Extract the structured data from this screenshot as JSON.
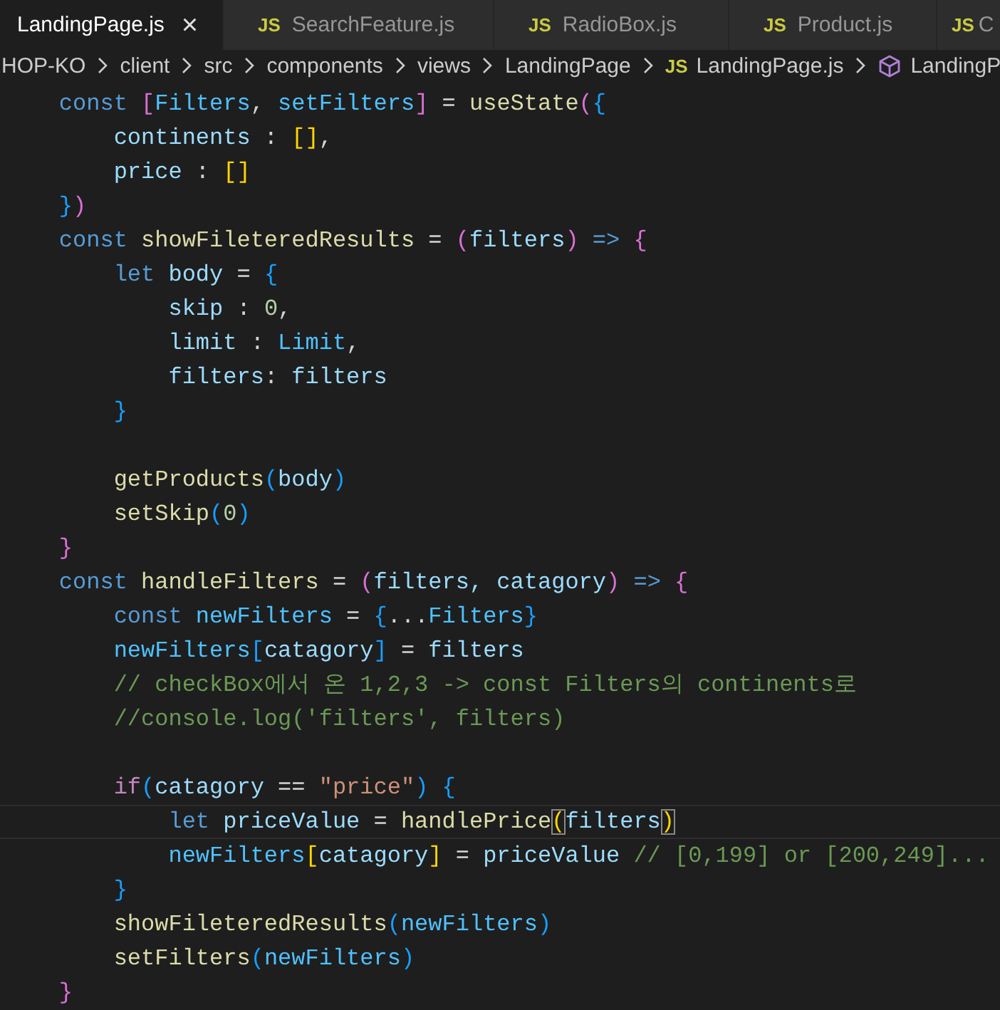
{
  "tabs": [
    {
      "label": "LandingPage.js",
      "selected": true,
      "close": "×"
    },
    {
      "badge": "JS",
      "label": "SearchFeature.js",
      "selected": false
    },
    {
      "badge": "JS",
      "label": "RadioBox.js",
      "selected": false
    },
    {
      "badge": "JS",
      "label": "Product.js",
      "selected": false
    },
    {
      "badge": "JS",
      "label": "C",
      "selected": false
    }
  ],
  "breadcrumb": [
    {
      "kind": "folder",
      "label": "HOP-KO"
    },
    {
      "kind": "folder",
      "label": "client"
    },
    {
      "kind": "folder",
      "label": "src"
    },
    {
      "kind": "folder",
      "label": "components"
    },
    {
      "kind": "folder",
      "label": "views"
    },
    {
      "kind": "folder",
      "label": "LandingPage"
    },
    {
      "kind": "file",
      "badge": "JS",
      "label": "LandingPage.js"
    },
    {
      "kind": "symbol",
      "label": "LandingP"
    }
  ],
  "code": [
    {
      "current": false,
      "tokens": [
        {
          "kind": "kw",
          "text": "    const "
        },
        {
          "kind": "b2",
          "text": "["
        },
        {
          "kind": "cst",
          "text": "Filters"
        },
        {
          "kind": "txt",
          "text": ", "
        },
        {
          "kind": "cst",
          "text": "setFilters"
        },
        {
          "kind": "b2",
          "text": "]"
        },
        {
          "kind": "txt",
          "text": " = "
        },
        {
          "kind": "fn",
          "text": "useState"
        },
        {
          "kind": "b2",
          "text": "("
        },
        {
          "kind": "b3",
          "text": "{"
        }
      ]
    },
    {
      "current": false,
      "tokens": [
        {
          "kind": "var",
          "text": "        continents"
        },
        {
          "kind": "txt",
          "text": " : "
        },
        {
          "kind": "b1",
          "text": "[]"
        },
        {
          "kind": "txt",
          "text": ","
        }
      ]
    },
    {
      "current": false,
      "tokens": [
        {
          "kind": "var",
          "text": "        price"
        },
        {
          "kind": "txt",
          "text": " : "
        },
        {
          "kind": "b1",
          "text": "[]"
        }
      ]
    },
    {
      "current": false,
      "tokens": [
        {
          "kind": "b3",
          "text": "    }"
        },
        {
          "kind": "b2",
          "text": ")"
        }
      ]
    },
    {
      "current": false,
      "tokens": [
        {
          "kind": "kw",
          "text": "    const "
        },
        {
          "kind": "fn",
          "text": "showFileteredResults"
        },
        {
          "kind": "txt",
          "text": " = "
        },
        {
          "kind": "b2",
          "text": "("
        },
        {
          "kind": "var",
          "text": "filters"
        },
        {
          "kind": "b2",
          "text": ")"
        },
        {
          "kind": "kw",
          "text": " => "
        },
        {
          "kind": "b2",
          "text": "{"
        }
      ]
    },
    {
      "current": false,
      "tokens": [
        {
          "kind": "kw",
          "text": "        let "
        },
        {
          "kind": "var",
          "text": "body"
        },
        {
          "kind": "txt",
          "text": " = "
        },
        {
          "kind": "b3",
          "text": "{"
        }
      ]
    },
    {
      "current": false,
      "tokens": [
        {
          "kind": "var",
          "text": "            skip"
        },
        {
          "kind": "txt",
          "text": " : "
        },
        {
          "kind": "num",
          "text": "0"
        },
        {
          "kind": "txt",
          "text": ","
        }
      ]
    },
    {
      "current": false,
      "tokens": [
        {
          "kind": "var",
          "text": "            limit"
        },
        {
          "kind": "txt",
          "text": " : "
        },
        {
          "kind": "cst",
          "text": "Limit"
        },
        {
          "kind": "txt",
          "text": ","
        }
      ]
    },
    {
      "current": false,
      "tokens": [
        {
          "kind": "var",
          "text": "            filters"
        },
        {
          "kind": "txt",
          "text": ": "
        },
        {
          "kind": "var",
          "text": "filters"
        }
      ]
    },
    {
      "current": false,
      "tokens": [
        {
          "kind": "b3",
          "text": "        }"
        }
      ]
    },
    {
      "current": false
    },
    {
      "current": false,
      "tokens": [
        {
          "kind": "fn",
          "text": "        getProducts"
        },
        {
          "kind": "b3",
          "text": "("
        },
        {
          "kind": "var",
          "text": "body"
        },
        {
          "kind": "b3",
          "text": ")"
        }
      ]
    },
    {
      "current": false,
      "tokens": [
        {
          "kind": "fn",
          "text": "        setSkip"
        },
        {
          "kind": "b3",
          "text": "("
        },
        {
          "kind": "num",
          "text": "0"
        },
        {
          "kind": "b3",
          "text": ")"
        }
      ]
    },
    {
      "current": false,
      "tokens": [
        {
          "kind": "b2",
          "text": "    }"
        }
      ]
    },
    {
      "current": false,
      "tokens": [
        {
          "kind": "kw",
          "text": "    const "
        },
        {
          "kind": "fn",
          "text": "handleFilters"
        },
        {
          "kind": "txt",
          "text": " = "
        },
        {
          "kind": "b2",
          "text": "("
        },
        {
          "kind": "var",
          "text": "filters, catagory"
        },
        {
          "kind": "b2",
          "text": ")"
        },
        {
          "kind": "kw",
          "text": " => "
        },
        {
          "kind": "b2",
          "text": "{"
        }
      ]
    },
    {
      "current": false,
      "tokens": [
        {
          "kind": "kw",
          "text": "        const "
        },
        {
          "kind": "cst",
          "text": "newFilters"
        },
        {
          "kind": "txt",
          "text": " = "
        },
        {
          "kind": "b3",
          "text": "{"
        },
        {
          "kind": "txt",
          "text": "..."
        },
        {
          "kind": "cst",
          "text": "Filters"
        },
        {
          "kind": "b3",
          "text": "}"
        }
      ]
    },
    {
      "current": false,
      "tokens": [
        {
          "kind": "cst",
          "text": "        newFilters"
        },
        {
          "kind": "b3",
          "text": "["
        },
        {
          "kind": "var",
          "text": "catagory"
        },
        {
          "kind": "b3",
          "text": "]"
        },
        {
          "kind": "txt",
          "text": " = "
        },
        {
          "kind": "var",
          "text": "filters"
        }
      ]
    },
    {
      "current": false,
      "tokens": [
        {
          "kind": "com",
          "text": "        // checkBox에서 온 1,2,3 -> const Filters의 continents로"
        }
      ]
    },
    {
      "current": false,
      "tokens": [
        {
          "kind": "com",
          "text": "        //console.log('filters', filters)"
        }
      ]
    },
    {
      "current": false
    },
    {
      "current": false,
      "tokens": [
        {
          "kind": "ctl",
          "text": "        if"
        },
        {
          "kind": "b3",
          "text": "("
        },
        {
          "kind": "var",
          "text": "catagory"
        },
        {
          "kind": "txt",
          "text": " == "
        },
        {
          "kind": "str",
          "text": "\"price\""
        },
        {
          "kind": "b3",
          "text": ")"
        },
        {
          "kind": "b3",
          "text": " {"
        }
      ]
    },
    {
      "current": true,
      "tokens": [
        {
          "kind": "kw",
          "text": "            let "
        },
        {
          "kind": "var",
          "text": "priceValue"
        },
        {
          "kind": "txt",
          "text": " = "
        },
        {
          "kind": "fn",
          "text": "handlePrice"
        },
        {
          "kind": "b1",
          "text": "(",
          "matched": true
        },
        {
          "kind": "var",
          "text": "filters"
        },
        {
          "kind": "b1",
          "text": ")",
          "matched": true
        }
      ]
    },
    {
      "current": false,
      "tokens": [
        {
          "kind": "cst",
          "text": "            newFilters"
        },
        {
          "kind": "b1",
          "text": "["
        },
        {
          "kind": "var",
          "text": "catagory"
        },
        {
          "kind": "b1",
          "text": "]"
        },
        {
          "kind": "txt",
          "text": " = "
        },
        {
          "kind": "var",
          "text": "priceValue"
        },
        {
          "kind": "com",
          "text": " // [0,199] or [200,249]..."
        }
      ]
    },
    {
      "current": false,
      "tokens": [
        {
          "kind": "b3",
          "text": "        }"
        }
      ]
    },
    {
      "current": false,
      "tokens": [
        {
          "kind": "fn",
          "text": "        showFileteredResults"
        },
        {
          "kind": "b3",
          "text": "("
        },
        {
          "kind": "cst",
          "text": "newFilters"
        },
        {
          "kind": "b3",
          "text": ")"
        }
      ]
    },
    {
      "current": false,
      "tokens": [
        {
          "kind": "fn",
          "text": "        setFilters"
        },
        {
          "kind": "b3",
          "text": "("
        },
        {
          "kind": "cst",
          "text": "newFilters"
        },
        {
          "kind": "b3",
          "text": ")"
        }
      ]
    },
    {
      "current": false,
      "tokens": [
        {
          "kind": "b2",
          "text": "    }"
        }
      ]
    }
  ]
}
